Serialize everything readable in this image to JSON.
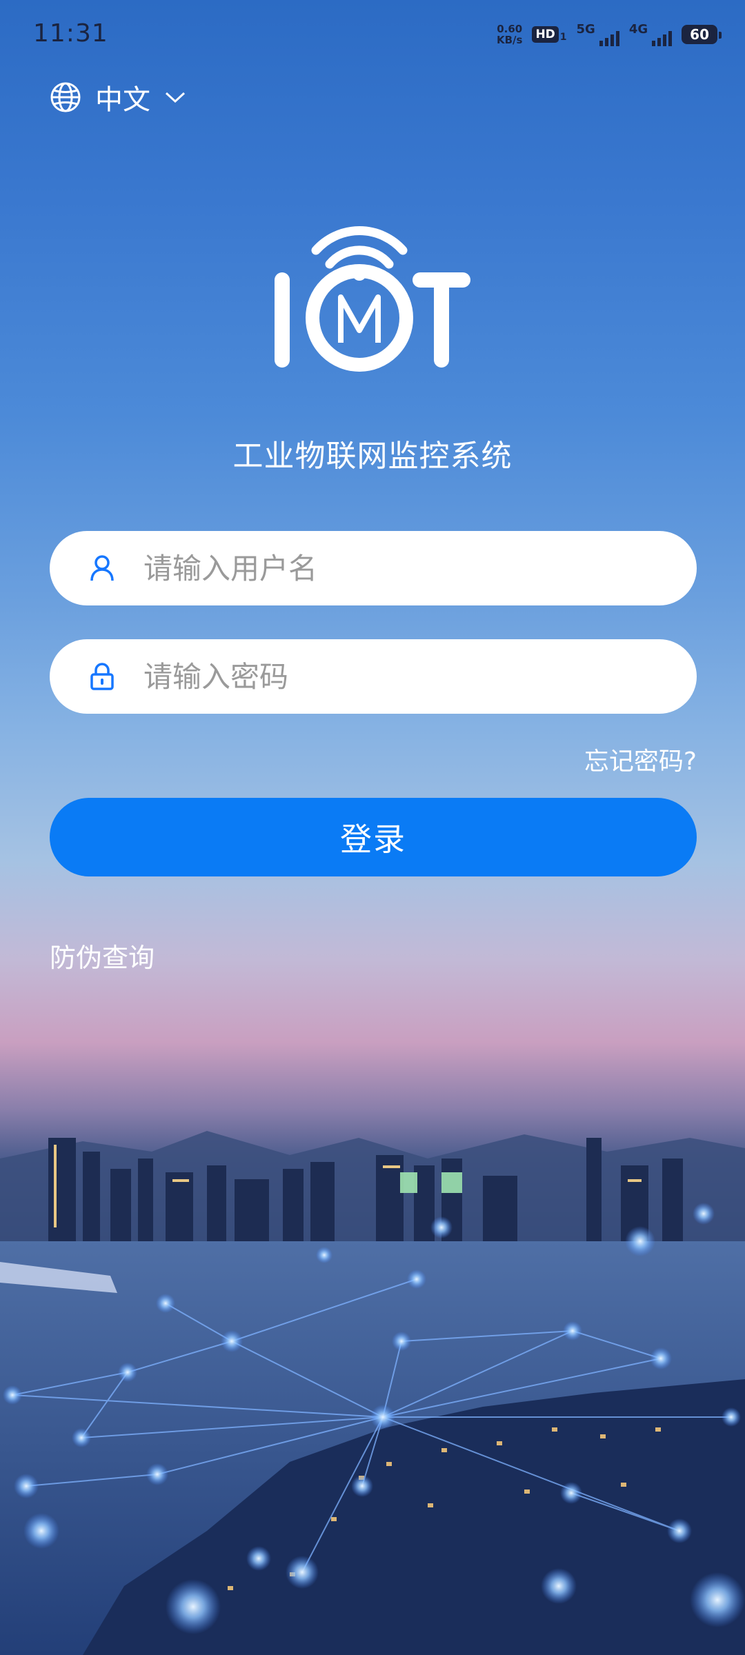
{
  "status_bar": {
    "time": "11:31",
    "net_speed_value": "0.60",
    "net_speed_unit": "KB/s",
    "hd_label": "HD",
    "hd_sub": "1",
    "signal_5g": "5G",
    "signal_4g": "4G",
    "battery": "60"
  },
  "language": {
    "current": "中文",
    "icon": "globe-icon"
  },
  "app": {
    "logo": "IOT",
    "title": "工业物联网监控系统"
  },
  "form": {
    "username_placeholder": "请输入用户名",
    "password_placeholder": "请输入密码",
    "forgot_password": "忘记密码?",
    "login_button": "登录",
    "anti_counterfeit": "防伪查询"
  },
  "colors": {
    "primary_button": "#0a7bf5",
    "icon_blue": "#1677ff"
  }
}
